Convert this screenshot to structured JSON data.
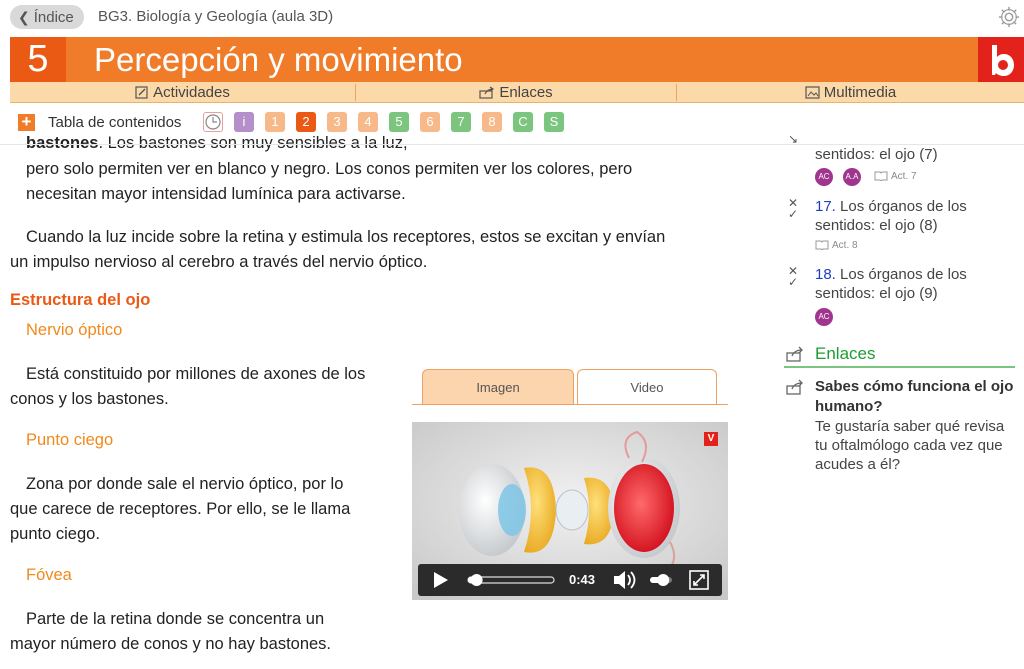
{
  "topbar": {
    "back_label": "Índice",
    "book_title": "BG3. Biología y Geología (aula 3D)"
  },
  "chapter": {
    "number": "5",
    "title": "Percepción y movimiento"
  },
  "subnav": {
    "actividades": "Actividades",
    "enlaces": "Enlaces",
    "multimedia": "Multimedia"
  },
  "toc": {
    "label": "Tabla de contenidos",
    "chips": [
      {
        "label": "i",
        "color": "#b48fc9"
      },
      {
        "label": "1",
        "color": "#f7b98a"
      },
      {
        "label": "2",
        "color": "#ea5a14"
      },
      {
        "label": "3",
        "color": "#f7b98a"
      },
      {
        "label": "4",
        "color": "#f7b98a"
      },
      {
        "label": "5",
        "color": "#7cc57e"
      },
      {
        "label": "6",
        "color": "#f7b98a"
      },
      {
        "label": "7",
        "color": "#7cc57e"
      },
      {
        "label": "8",
        "color": "#f7b98a"
      },
      {
        "label": "C",
        "color": "#7cc57e"
      },
      {
        "label": "S",
        "color": "#7cc57e"
      }
    ]
  },
  "main": {
    "line0_bold": "bastones",
    "line0_rest": ". Los bastones son muy sensibles a la luz,",
    "line1": "pero solo permiten ver en blanco y negro. Los conos permiten ver los colores, pero",
    "line2": "necesitan mayor intensidad lumínica para activarse.",
    "para2_l1": "Cuando la luz incide sobre la retina y estimula los receptores, estos se excitan y envían",
    "para2_l2": "un impulso nervioso al cerebro a través del nervio óptico.",
    "section_title": "Estructura del ojo",
    "nervio_title": "Nervio óptico",
    "nervio_l1": "Está constituido por millones de axones de los",
    "nervio_l2": "conos y los bastones.",
    "punto_title": "Punto ciego",
    "punto_l1": "Zona por donde sale el nervio óptico, por lo",
    "punto_l2": "que carece de receptores. Por ello, se le llama",
    "punto_l3": "punto ciego.",
    "fovea_title": "Fóvea",
    "fovea_l1": "Parte de la retina donde se concentra un",
    "fovea_l2": "mayor número de conos y no hay bastones."
  },
  "media": {
    "tab_image": "Imagen",
    "tab_video": "Video",
    "time": "0:43",
    "progress": 0.1,
    "volume": 0.6
  },
  "sidebar": {
    "item16_l1": "sentidos: el ojo (7)",
    "item17_num": "17.",
    "item17_l1": " Los órganos de los",
    "item17_l2": "sentidos: el ojo (8)",
    "item17_act": "Act. 8",
    "item16_act": "Act. 7",
    "item18_num": "18.",
    "item18_l1": " Los órganos de los",
    "item18_l2": "sentidos: el ojo (9)",
    "enlaces_heading": "Enlaces",
    "link_title": "Sabes cómo funciona el ojo humano?",
    "link_desc": "Te gustaría saber qué revisa tu oftalmólogo cada vez que acudes a él?"
  }
}
